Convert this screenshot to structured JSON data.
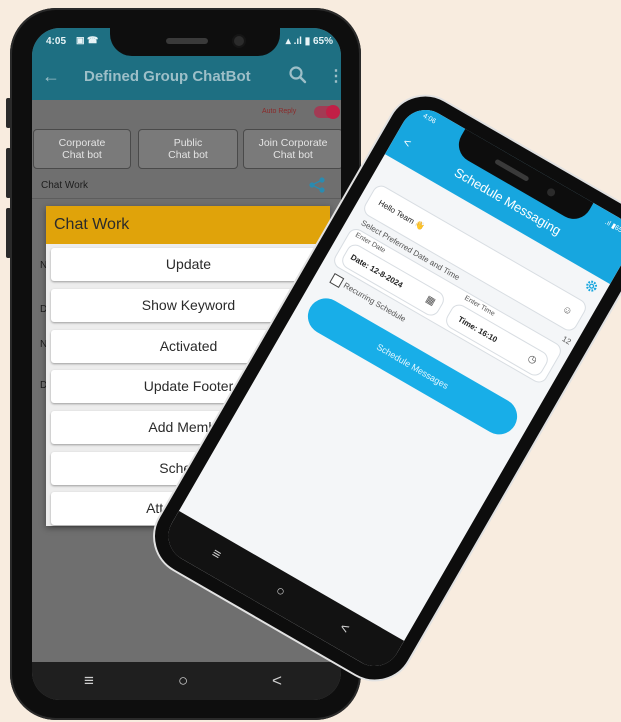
{
  "background_color": "#f8ecdf",
  "phone1": {
    "status": {
      "time": "4:05",
      "right": "▴ .ıl ▮ 65%"
    },
    "toolbar": {
      "back_icon": "←",
      "title": "Defined Group ChatBot",
      "search_icon": "search-icon",
      "menu_icon": "⋮"
    },
    "auto_reply_label": "Auto Reply",
    "categories": [
      {
        "line1": "Corporate",
        "line2": "Chat bot"
      },
      {
        "line1": "Public",
        "line2": "Chat bot"
      },
      {
        "line1": "Join Corporate",
        "line2": "Chat bot"
      }
    ],
    "list_title": "Chat Work",
    "bg_letters": [
      "N",
      "D",
      "N",
      "D"
    ],
    "dialog": {
      "title": "Chat Work",
      "items": [
        "Update",
        "Show Keyword",
        "Activated",
        "Update Footer",
        "Add Member",
        "Schedule",
        "Attached Hea"
      ]
    },
    "nav": {
      "recent": "≡",
      "home": "○",
      "back": "<"
    }
  },
  "phone2": {
    "status": {
      "time": "4:06",
      "right": ".ıl ▮65%"
    },
    "header": {
      "back_icon": "<",
      "title": "Schedule Messaging"
    },
    "message": "Hello Team 👋",
    "preferred_label": "Select Preferred Date and Time",
    "date_label": "Enter Date",
    "date_value": "Date: 12-8-2024",
    "time_label": "Enter Time",
    "time_value": "Time: 16:10",
    "recurring_label": "Recurring Schedule",
    "button_label": "Schedule Messages",
    "side_number": "12",
    "nav": {
      "recent": "≡",
      "home": "○",
      "back": "<"
    }
  }
}
